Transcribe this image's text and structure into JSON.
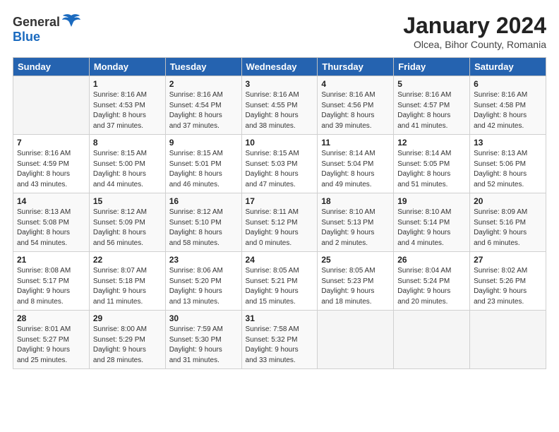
{
  "header": {
    "logo_general": "General",
    "logo_blue": "Blue",
    "month_title": "January 2024",
    "subtitle": "Olcea, Bihor County, Romania"
  },
  "days_of_week": [
    "Sunday",
    "Monday",
    "Tuesday",
    "Wednesday",
    "Thursday",
    "Friday",
    "Saturday"
  ],
  "weeks": [
    [
      {
        "day": "",
        "info": ""
      },
      {
        "day": "1",
        "info": "Sunrise: 8:16 AM\nSunset: 4:53 PM\nDaylight: 8 hours\nand 37 minutes."
      },
      {
        "day": "2",
        "info": "Sunrise: 8:16 AM\nSunset: 4:54 PM\nDaylight: 8 hours\nand 37 minutes."
      },
      {
        "day": "3",
        "info": "Sunrise: 8:16 AM\nSunset: 4:55 PM\nDaylight: 8 hours\nand 38 minutes."
      },
      {
        "day": "4",
        "info": "Sunrise: 8:16 AM\nSunset: 4:56 PM\nDaylight: 8 hours\nand 39 minutes."
      },
      {
        "day": "5",
        "info": "Sunrise: 8:16 AM\nSunset: 4:57 PM\nDaylight: 8 hours\nand 41 minutes."
      },
      {
        "day": "6",
        "info": "Sunrise: 8:16 AM\nSunset: 4:58 PM\nDaylight: 8 hours\nand 42 minutes."
      }
    ],
    [
      {
        "day": "7",
        "info": "Sunrise: 8:16 AM\nSunset: 4:59 PM\nDaylight: 8 hours\nand 43 minutes."
      },
      {
        "day": "8",
        "info": "Sunrise: 8:15 AM\nSunset: 5:00 PM\nDaylight: 8 hours\nand 44 minutes."
      },
      {
        "day": "9",
        "info": "Sunrise: 8:15 AM\nSunset: 5:01 PM\nDaylight: 8 hours\nand 46 minutes."
      },
      {
        "day": "10",
        "info": "Sunrise: 8:15 AM\nSunset: 5:03 PM\nDaylight: 8 hours\nand 47 minutes."
      },
      {
        "day": "11",
        "info": "Sunrise: 8:14 AM\nSunset: 5:04 PM\nDaylight: 8 hours\nand 49 minutes."
      },
      {
        "day": "12",
        "info": "Sunrise: 8:14 AM\nSunset: 5:05 PM\nDaylight: 8 hours\nand 51 minutes."
      },
      {
        "day": "13",
        "info": "Sunrise: 8:13 AM\nSunset: 5:06 PM\nDaylight: 8 hours\nand 52 minutes."
      }
    ],
    [
      {
        "day": "14",
        "info": "Sunrise: 8:13 AM\nSunset: 5:08 PM\nDaylight: 8 hours\nand 54 minutes."
      },
      {
        "day": "15",
        "info": "Sunrise: 8:12 AM\nSunset: 5:09 PM\nDaylight: 8 hours\nand 56 minutes."
      },
      {
        "day": "16",
        "info": "Sunrise: 8:12 AM\nSunset: 5:10 PM\nDaylight: 8 hours\nand 58 minutes."
      },
      {
        "day": "17",
        "info": "Sunrise: 8:11 AM\nSunset: 5:12 PM\nDaylight: 9 hours\nand 0 minutes."
      },
      {
        "day": "18",
        "info": "Sunrise: 8:10 AM\nSunset: 5:13 PM\nDaylight: 9 hours\nand 2 minutes."
      },
      {
        "day": "19",
        "info": "Sunrise: 8:10 AM\nSunset: 5:14 PM\nDaylight: 9 hours\nand 4 minutes."
      },
      {
        "day": "20",
        "info": "Sunrise: 8:09 AM\nSunset: 5:16 PM\nDaylight: 9 hours\nand 6 minutes."
      }
    ],
    [
      {
        "day": "21",
        "info": "Sunrise: 8:08 AM\nSunset: 5:17 PM\nDaylight: 9 hours\nand 8 minutes."
      },
      {
        "day": "22",
        "info": "Sunrise: 8:07 AM\nSunset: 5:18 PM\nDaylight: 9 hours\nand 11 minutes."
      },
      {
        "day": "23",
        "info": "Sunrise: 8:06 AM\nSunset: 5:20 PM\nDaylight: 9 hours\nand 13 minutes."
      },
      {
        "day": "24",
        "info": "Sunrise: 8:05 AM\nSunset: 5:21 PM\nDaylight: 9 hours\nand 15 minutes."
      },
      {
        "day": "25",
        "info": "Sunrise: 8:05 AM\nSunset: 5:23 PM\nDaylight: 9 hours\nand 18 minutes."
      },
      {
        "day": "26",
        "info": "Sunrise: 8:04 AM\nSunset: 5:24 PM\nDaylight: 9 hours\nand 20 minutes."
      },
      {
        "day": "27",
        "info": "Sunrise: 8:02 AM\nSunset: 5:26 PM\nDaylight: 9 hours\nand 23 minutes."
      }
    ],
    [
      {
        "day": "28",
        "info": "Sunrise: 8:01 AM\nSunset: 5:27 PM\nDaylight: 9 hours\nand 25 minutes."
      },
      {
        "day": "29",
        "info": "Sunrise: 8:00 AM\nSunset: 5:29 PM\nDaylight: 9 hours\nand 28 minutes."
      },
      {
        "day": "30",
        "info": "Sunrise: 7:59 AM\nSunset: 5:30 PM\nDaylight: 9 hours\nand 31 minutes."
      },
      {
        "day": "31",
        "info": "Sunrise: 7:58 AM\nSunset: 5:32 PM\nDaylight: 9 hours\nand 33 minutes."
      },
      {
        "day": "",
        "info": ""
      },
      {
        "day": "",
        "info": ""
      },
      {
        "day": "",
        "info": ""
      }
    ]
  ]
}
